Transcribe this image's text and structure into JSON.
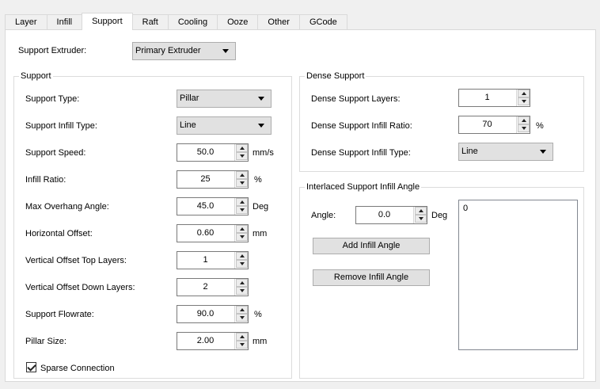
{
  "tabs": [
    "Layer",
    "Infill",
    "Support",
    "Raft",
    "Cooling",
    "Ooze",
    "Other",
    "GCode"
  ],
  "active_tab": "Support",
  "support_extruder": {
    "label": "Support Extruder:",
    "value": "Primary Extruder"
  },
  "support_group": {
    "title": "Support",
    "support_type": {
      "label": "Support Type:",
      "value": "Pillar"
    },
    "support_infill_type": {
      "label": "Support Infill Type:",
      "value": "Line"
    },
    "support_speed": {
      "label": "Support Speed:",
      "value": "50.0",
      "unit": "mm/s"
    },
    "infill_ratio": {
      "label": "Infill Ratio:",
      "value": "25",
      "unit": "%"
    },
    "max_overhang_angle": {
      "label": "Max Overhang Angle:",
      "value": "45.0",
      "unit": "Deg"
    },
    "horizontal_offset": {
      "label": "Horizontal Offset:",
      "value": "0.60",
      "unit": "mm"
    },
    "vertical_offset_top": {
      "label": "Vertical Offset Top Layers:",
      "value": "1"
    },
    "vertical_offset_down": {
      "label": "Vertical Offset Down Layers:",
      "value": "2"
    },
    "support_flowrate": {
      "label": "Support Flowrate:",
      "value": "90.0",
      "unit": "%"
    },
    "pillar_size": {
      "label": "Pillar Size:",
      "value": "2.00",
      "unit": "mm"
    },
    "sparse_connection": {
      "label": "Sparse Connection",
      "checked": true
    }
  },
  "dense_group": {
    "title": "Dense Support",
    "layers": {
      "label": "Dense Support Layers:",
      "value": "1"
    },
    "infill_ratio": {
      "label": "Dense Support Infill Ratio:",
      "value": "70",
      "unit": "%"
    },
    "infill_type": {
      "label": "Dense Support Infill Type:",
      "value": "Line"
    }
  },
  "interlaced_group": {
    "title": "Interlaced Support Infill Angle",
    "angle": {
      "label": "Angle:",
      "value": "0.0",
      "unit": "Deg"
    },
    "add_button": "Add Infill Angle",
    "remove_button": "Remove Infill Angle",
    "angles": [
      "0"
    ]
  }
}
